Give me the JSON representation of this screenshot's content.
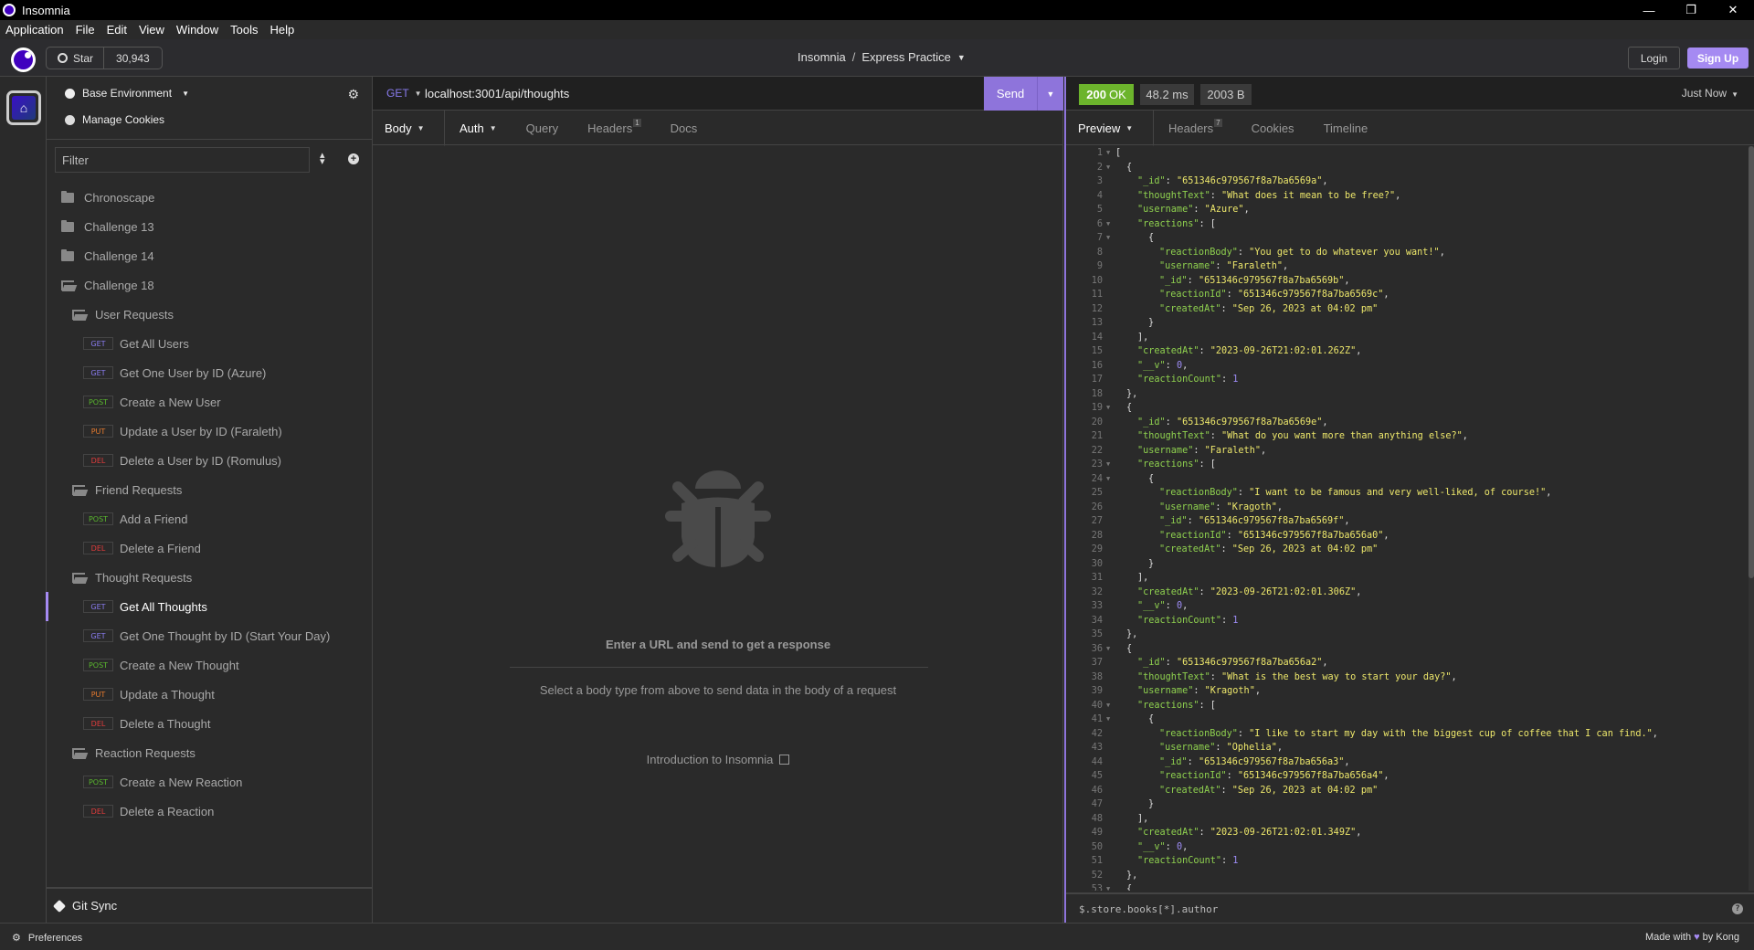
{
  "window": {
    "title": "Insomnia",
    "controls": {
      "minimize": "—",
      "restore": "❐",
      "close": "✕"
    }
  },
  "menu": [
    "Application",
    "File",
    "Edit",
    "View",
    "Window",
    "Tools",
    "Help"
  ],
  "header": {
    "star_label": "Star",
    "star_count": "30,943",
    "breadcrumb_root": "Insomnia",
    "breadcrumb_sep": "/",
    "project": "Express Practice",
    "login_label": "Login",
    "signup_label": "Sign Up"
  },
  "sidebar": {
    "environment": "Base Environment",
    "manage_cookies": "Manage Cookies",
    "filter_placeholder": "Filter",
    "tree": [
      {
        "type": "folder",
        "state": "closed",
        "level": 0,
        "label": "Chronoscape"
      },
      {
        "type": "folder",
        "state": "closed",
        "level": 0,
        "label": "Challenge 13"
      },
      {
        "type": "folder",
        "state": "closed",
        "level": 0,
        "label": "Challenge 14"
      },
      {
        "type": "folder",
        "state": "open",
        "level": 0,
        "label": "Challenge 18"
      },
      {
        "type": "folder",
        "state": "open",
        "level": 1,
        "label": "User Requests"
      },
      {
        "type": "request",
        "level": 2,
        "method": "GET",
        "label": "Get All Users"
      },
      {
        "type": "request",
        "level": 2,
        "method": "GET",
        "label": "Get One User by ID (Azure)"
      },
      {
        "type": "request",
        "level": 2,
        "method": "POST",
        "label": "Create a New User"
      },
      {
        "type": "request",
        "level": 2,
        "method": "PUT",
        "label": "Update a User by ID (Faraleth)"
      },
      {
        "type": "request",
        "level": 2,
        "method": "DEL",
        "label": "Delete a User by ID (Romulus)"
      },
      {
        "type": "folder",
        "state": "open",
        "level": 1,
        "label": "Friend Requests"
      },
      {
        "type": "request",
        "level": 2,
        "method": "POST",
        "label": "Add a Friend"
      },
      {
        "type": "request",
        "level": 2,
        "method": "DEL",
        "label": "Delete a Friend"
      },
      {
        "type": "folder",
        "state": "open",
        "level": 1,
        "label": "Thought Requests"
      },
      {
        "type": "request",
        "level": 2,
        "method": "GET",
        "label": "Get All Thoughts",
        "active": true
      },
      {
        "type": "request",
        "level": 2,
        "method": "GET",
        "label": "Get One Thought by ID (Start Your Day)"
      },
      {
        "type": "request",
        "level": 2,
        "method": "POST",
        "label": "Create a New Thought"
      },
      {
        "type": "request",
        "level": 2,
        "method": "PUT",
        "label": "Update a Thought"
      },
      {
        "type": "request",
        "level": 2,
        "method": "DEL",
        "label": "Delete a Thought"
      },
      {
        "type": "folder",
        "state": "open",
        "level": 1,
        "label": "Reaction Requests"
      },
      {
        "type": "request",
        "level": 2,
        "method": "POST",
        "label": "Create a New Reaction"
      },
      {
        "type": "request",
        "level": 2,
        "method": "DEL",
        "label": "Delete a Reaction"
      }
    ],
    "git_sync": "Git Sync"
  },
  "request": {
    "method": "GET",
    "url": "localhost:3001/api/thoughts",
    "send_label": "Send",
    "tabs": {
      "body": "Body",
      "auth": "Auth",
      "query": "Query",
      "headers": "Headers",
      "headers_count": "1",
      "docs": "Docs"
    },
    "empty_title": "Enter a URL and send to get a response",
    "empty_sub": "Select a body type from above to send data in the body of a request",
    "intro_link": "Introduction to Insomnia"
  },
  "response": {
    "status_code": "200",
    "status_text": "OK",
    "time": "48.2 ms",
    "size": "2003 B",
    "history": "Just Now",
    "tabs": {
      "preview": "Preview",
      "headers": "Headers",
      "headers_count": "7",
      "cookies": "Cookies",
      "timeline": "Timeline"
    },
    "scroll_visible_fraction": 0.58,
    "body_lines": [
      {
        "n": 1,
        "f": true,
        "i": 0,
        "t": [
          [
            "p",
            "["
          ]
        ]
      },
      {
        "n": 2,
        "f": true,
        "i": 1,
        "t": [
          [
            "p",
            "{"
          ]
        ]
      },
      {
        "n": 3,
        "i": 2,
        "t": [
          [
            "k",
            "\"_id\""
          ],
          [
            "p",
            ": "
          ],
          [
            "s",
            "\"651346c979567f8a7ba6569a\""
          ],
          [
            "p",
            ","
          ]
        ]
      },
      {
        "n": 4,
        "i": 2,
        "t": [
          [
            "k",
            "\"thoughtText\""
          ],
          [
            "p",
            ": "
          ],
          [
            "s",
            "\"What does it mean to be free?\""
          ],
          [
            "p",
            ","
          ]
        ]
      },
      {
        "n": 5,
        "i": 2,
        "t": [
          [
            "k",
            "\"username\""
          ],
          [
            "p",
            ": "
          ],
          [
            "s",
            "\"Azure\""
          ],
          [
            "p",
            ","
          ]
        ]
      },
      {
        "n": 6,
        "f": true,
        "i": 2,
        "t": [
          [
            "k",
            "\"reactions\""
          ],
          [
            "p",
            ": ["
          ]
        ]
      },
      {
        "n": 7,
        "f": true,
        "i": 3,
        "t": [
          [
            "p",
            "{"
          ]
        ]
      },
      {
        "n": 8,
        "i": 4,
        "t": [
          [
            "k",
            "\"reactionBody\""
          ],
          [
            "p",
            ": "
          ],
          [
            "s",
            "\"You get to do whatever you want!\""
          ],
          [
            "p",
            ","
          ]
        ]
      },
      {
        "n": 9,
        "i": 4,
        "t": [
          [
            "k",
            "\"username\""
          ],
          [
            "p",
            ": "
          ],
          [
            "s",
            "\"Faraleth\""
          ],
          [
            "p",
            ","
          ]
        ]
      },
      {
        "n": 10,
        "i": 4,
        "t": [
          [
            "k",
            "\"_id\""
          ],
          [
            "p",
            ": "
          ],
          [
            "s",
            "\"651346c979567f8a7ba6569b\""
          ],
          [
            "p",
            ","
          ]
        ]
      },
      {
        "n": 11,
        "i": 4,
        "t": [
          [
            "k",
            "\"reactionId\""
          ],
          [
            "p",
            ": "
          ],
          [
            "s",
            "\"651346c979567f8a7ba6569c\""
          ],
          [
            "p",
            ","
          ]
        ]
      },
      {
        "n": 12,
        "i": 4,
        "t": [
          [
            "k",
            "\"createdAt\""
          ],
          [
            "p",
            ": "
          ],
          [
            "s",
            "\"Sep 26, 2023 at 04:02 pm\""
          ]
        ]
      },
      {
        "n": 13,
        "i": 3,
        "t": [
          [
            "p",
            "}"
          ]
        ]
      },
      {
        "n": 14,
        "i": 2,
        "t": [
          [
            "p",
            "],"
          ]
        ]
      },
      {
        "n": 15,
        "i": 2,
        "t": [
          [
            "k",
            "\"createdAt\""
          ],
          [
            "p",
            ": "
          ],
          [
            "s",
            "\"2023-09-26T21:02:01.262Z\""
          ],
          [
            "p",
            ","
          ]
        ]
      },
      {
        "n": 16,
        "i": 2,
        "t": [
          [
            "k",
            "\"__v\""
          ],
          [
            "p",
            ": "
          ],
          [
            "n",
            "0"
          ],
          [
            "p",
            ","
          ]
        ]
      },
      {
        "n": 17,
        "i": 2,
        "t": [
          [
            "k",
            "\"reactionCount\""
          ],
          [
            "p",
            ": "
          ],
          [
            "n",
            "1"
          ]
        ]
      },
      {
        "n": 18,
        "i": 1,
        "t": [
          [
            "p",
            "},"
          ]
        ]
      },
      {
        "n": 19,
        "f": true,
        "i": 1,
        "t": [
          [
            "p",
            "{"
          ]
        ]
      },
      {
        "n": 20,
        "i": 2,
        "t": [
          [
            "k",
            "\"_id\""
          ],
          [
            "p",
            ": "
          ],
          [
            "s",
            "\"651346c979567f8a7ba6569e\""
          ],
          [
            "p",
            ","
          ]
        ]
      },
      {
        "n": 21,
        "i": 2,
        "t": [
          [
            "k",
            "\"thoughtText\""
          ],
          [
            "p",
            ": "
          ],
          [
            "s",
            "\"What do you want more than anything else?\""
          ],
          [
            "p",
            ","
          ]
        ]
      },
      {
        "n": 22,
        "i": 2,
        "t": [
          [
            "k",
            "\"username\""
          ],
          [
            "p",
            ": "
          ],
          [
            "s",
            "\"Faraleth\""
          ],
          [
            "p",
            ","
          ]
        ]
      },
      {
        "n": 23,
        "f": true,
        "i": 2,
        "t": [
          [
            "k",
            "\"reactions\""
          ],
          [
            "p",
            ": ["
          ]
        ]
      },
      {
        "n": 24,
        "f": true,
        "i": 3,
        "t": [
          [
            "p",
            "{"
          ]
        ]
      },
      {
        "n": 25,
        "i": 4,
        "t": [
          [
            "k",
            "\"reactionBody\""
          ],
          [
            "p",
            ": "
          ],
          [
            "s",
            "\"I want to be famous and very well-liked, of course!\""
          ],
          [
            "p",
            ","
          ]
        ]
      },
      {
        "n": 26,
        "i": 4,
        "t": [
          [
            "k",
            "\"username\""
          ],
          [
            "p",
            ": "
          ],
          [
            "s",
            "\"Kragoth\""
          ],
          [
            "p",
            ","
          ]
        ]
      },
      {
        "n": 27,
        "i": 4,
        "t": [
          [
            "k",
            "\"_id\""
          ],
          [
            "p",
            ": "
          ],
          [
            "s",
            "\"651346c979567f8a7ba6569f\""
          ],
          [
            "p",
            ","
          ]
        ]
      },
      {
        "n": 28,
        "i": 4,
        "t": [
          [
            "k",
            "\"reactionId\""
          ],
          [
            "p",
            ": "
          ],
          [
            "s",
            "\"651346c979567f8a7ba656a0\""
          ],
          [
            "p",
            ","
          ]
        ]
      },
      {
        "n": 29,
        "i": 4,
        "t": [
          [
            "k",
            "\"createdAt\""
          ],
          [
            "p",
            ": "
          ],
          [
            "s",
            "\"Sep 26, 2023 at 04:02 pm\""
          ]
        ]
      },
      {
        "n": 30,
        "i": 3,
        "t": [
          [
            "p",
            "}"
          ]
        ]
      },
      {
        "n": 31,
        "i": 2,
        "t": [
          [
            "p",
            "],"
          ]
        ]
      },
      {
        "n": 32,
        "i": 2,
        "t": [
          [
            "k",
            "\"createdAt\""
          ],
          [
            "p",
            ": "
          ],
          [
            "s",
            "\"2023-09-26T21:02:01.306Z\""
          ],
          [
            "p",
            ","
          ]
        ]
      },
      {
        "n": 33,
        "i": 2,
        "t": [
          [
            "k",
            "\"__v\""
          ],
          [
            "p",
            ": "
          ],
          [
            "n",
            "0"
          ],
          [
            "p",
            ","
          ]
        ]
      },
      {
        "n": 34,
        "i": 2,
        "t": [
          [
            "k",
            "\"reactionCount\""
          ],
          [
            "p",
            ": "
          ],
          [
            "n",
            "1"
          ]
        ]
      },
      {
        "n": 35,
        "i": 1,
        "t": [
          [
            "p",
            "},"
          ]
        ]
      },
      {
        "n": 36,
        "f": true,
        "i": 1,
        "t": [
          [
            "p",
            "{"
          ]
        ]
      },
      {
        "n": 37,
        "i": 2,
        "t": [
          [
            "k",
            "\"_id\""
          ],
          [
            "p",
            ": "
          ],
          [
            "s",
            "\"651346c979567f8a7ba656a2\""
          ],
          [
            "p",
            ","
          ]
        ]
      },
      {
        "n": 38,
        "i": 2,
        "t": [
          [
            "k",
            "\"thoughtText\""
          ],
          [
            "p",
            ": "
          ],
          [
            "s",
            "\"What is the best way to start your day?\""
          ],
          [
            "p",
            ","
          ]
        ]
      },
      {
        "n": 39,
        "i": 2,
        "t": [
          [
            "k",
            "\"username\""
          ],
          [
            "p",
            ": "
          ],
          [
            "s",
            "\"Kragoth\""
          ],
          [
            "p",
            ","
          ]
        ]
      },
      {
        "n": 40,
        "f": true,
        "i": 2,
        "t": [
          [
            "k",
            "\"reactions\""
          ],
          [
            "p",
            ": ["
          ]
        ]
      },
      {
        "n": 41,
        "f": true,
        "i": 3,
        "t": [
          [
            "p",
            "{"
          ]
        ]
      },
      {
        "n": 42,
        "i": 4,
        "t": [
          [
            "k",
            "\"reactionBody\""
          ],
          [
            "p",
            ": "
          ],
          [
            "s",
            "\"I like to start my day with the biggest cup of coffee that I can find.\""
          ],
          [
            "p",
            ","
          ]
        ]
      },
      {
        "n": 43,
        "i": 4,
        "t": [
          [
            "k",
            "\"username\""
          ],
          [
            "p",
            ": "
          ],
          [
            "s",
            "\"Ophelia\""
          ],
          [
            "p",
            ","
          ]
        ]
      },
      {
        "n": 44,
        "i": 4,
        "t": [
          [
            "k",
            "\"_id\""
          ],
          [
            "p",
            ": "
          ],
          [
            "s",
            "\"651346c979567f8a7ba656a3\""
          ],
          [
            "p",
            ","
          ]
        ]
      },
      {
        "n": 45,
        "i": 4,
        "t": [
          [
            "k",
            "\"reactionId\""
          ],
          [
            "p",
            ": "
          ],
          [
            "s",
            "\"651346c979567f8a7ba656a4\""
          ],
          [
            "p",
            ","
          ]
        ]
      },
      {
        "n": 46,
        "i": 4,
        "t": [
          [
            "k",
            "\"createdAt\""
          ],
          [
            "p",
            ": "
          ],
          [
            "s",
            "\"Sep 26, 2023 at 04:02 pm\""
          ]
        ]
      },
      {
        "n": 47,
        "i": 3,
        "t": [
          [
            "p",
            "}"
          ]
        ]
      },
      {
        "n": 48,
        "i": 2,
        "t": [
          [
            "p",
            "],"
          ]
        ]
      },
      {
        "n": 49,
        "i": 2,
        "t": [
          [
            "k",
            "\"createdAt\""
          ],
          [
            "p",
            ": "
          ],
          [
            "s",
            "\"2023-09-26T21:02:01.349Z\""
          ],
          [
            "p",
            ","
          ]
        ]
      },
      {
        "n": 50,
        "i": 2,
        "t": [
          [
            "k",
            "\"__v\""
          ],
          [
            "p",
            ": "
          ],
          [
            "n",
            "0"
          ],
          [
            "p",
            ","
          ]
        ]
      },
      {
        "n": 51,
        "i": 2,
        "t": [
          [
            "k",
            "\"reactionCount\""
          ],
          [
            "p",
            ": "
          ],
          [
            "n",
            "1"
          ]
        ]
      },
      {
        "n": 52,
        "i": 1,
        "t": [
          [
            "p",
            "},"
          ]
        ]
      },
      {
        "n": 53,
        "f": true,
        "i": 1,
        "t": [
          [
            "p",
            "{"
          ]
        ]
      }
    ],
    "filter_placeholder": "$.store.books[*].author"
  },
  "statusbar": {
    "preferences": "Preferences",
    "made_with_prefix": "Made with",
    "made_with_suffix": "by Kong"
  },
  "colors": {
    "accent": "#8e74db",
    "signup": "#a58af2",
    "status_ok": "#6cb42c",
    "method_get": "#8a7cf0",
    "method_post": "#5ab72e",
    "method_put": "#e87b2e",
    "method_del": "#e23c3c",
    "json_key": "#8fd14f",
    "json_string": "#ede76b",
    "json_number": "#9d8cf5"
  }
}
